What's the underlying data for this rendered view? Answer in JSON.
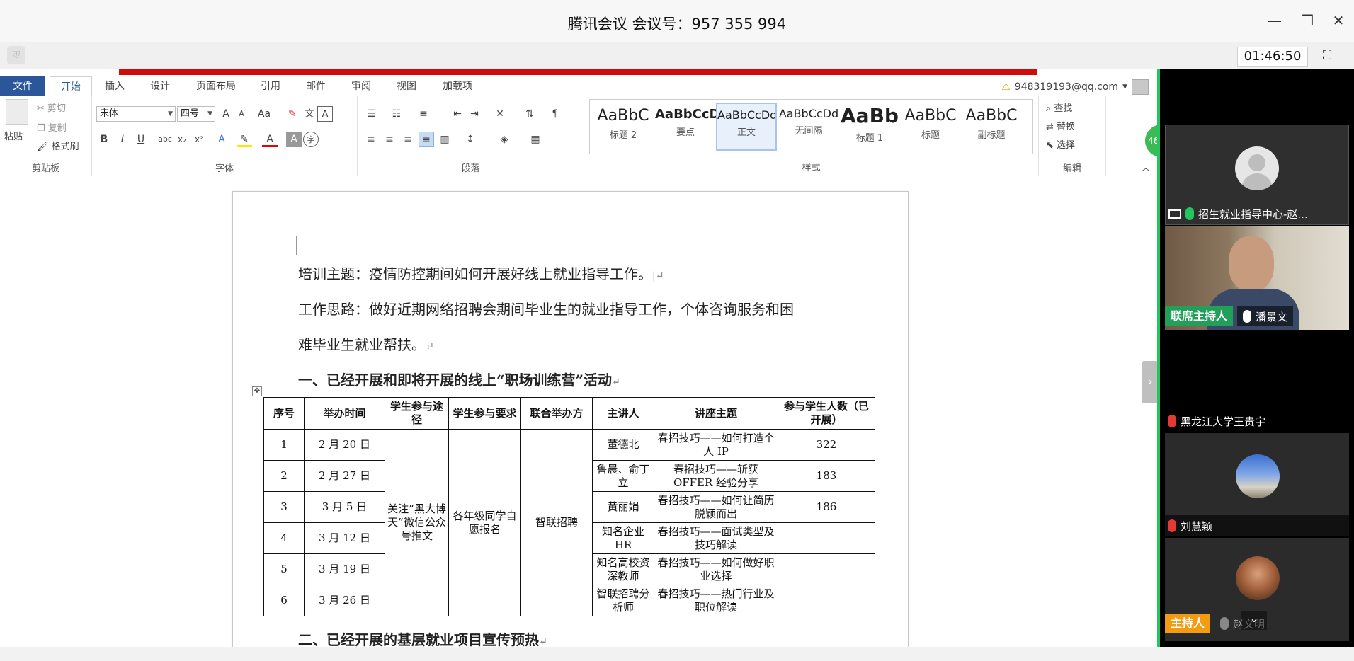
{
  "window": {
    "title": "腾讯会议 会议号：957 355 994",
    "timer": "01:46:50"
  },
  "word": {
    "tabs": [
      "文件",
      "开始",
      "插入",
      "设计",
      "页面布局",
      "引用",
      "邮件",
      "审阅",
      "视图",
      "加载项"
    ],
    "account": "948319193@qq.com",
    "clipboard": {
      "paste": "粘贴",
      "cut": "剪切",
      "copy": "复制",
      "format_painter": "格式刷",
      "label": "剪贴板"
    },
    "font": {
      "name": "宋体",
      "size": "四号",
      "label": "字体"
    },
    "paragraph_label": "段落",
    "styles": {
      "label": "样式",
      "items": [
        {
          "sample": "AaBbC",
          "name": "标题 2"
        },
        {
          "sample": "AaBbCcD",
          "name": "要点"
        },
        {
          "sample": "AaBbCcDd",
          "name": "正文"
        },
        {
          "sample": "AaBbCcDd",
          "name": "无间隔"
        },
        {
          "sample": "AaBb",
          "name": "标题 1"
        },
        {
          "sample": "AaBbC",
          "name": "标题"
        },
        {
          "sample": "AaBbC",
          "name": "副标题"
        }
      ]
    },
    "editing": {
      "find": "查找",
      "replace": "替换",
      "select": "选择",
      "label": "编辑"
    },
    "side_badge": "46"
  },
  "document": {
    "line1": "培训主题：疫情防控期间如何开展好线上就业指导工作。",
    "line2": "工作思路：做好近期网络招聘会期间毕业生的就业指导工作，个体咨询服务和困",
    "line3": "难毕业生就业帮扶。",
    "heading1": "一、已经开展和即将开展的线上“职场训练营”活动",
    "heading2": "二、已经开展的基层就业项目宣传预热",
    "table": {
      "headers": [
        "序号",
        "举办时间",
        "学生参与途径",
        "学生参与要求",
        "联合举办方",
        "主讲人",
        "讲座主题",
        "参与学生人数（已开展）"
      ],
      "merged": {
        "route": "关注“黑大博天”微信公众号推文",
        "requirement": "各年级同学自愿报名",
        "organizer": "智联招聘"
      },
      "rows": [
        {
          "no": "1",
          "date": "2 月 20 日",
          "speaker": "董德北",
          "topic": "春招技巧——如何打造个人 IP",
          "count": "322"
        },
        {
          "no": "2",
          "date": "2 月 27 日",
          "speaker": "鲁晨、俞丁立",
          "topic": "春招技巧——斩获 OFFER 经验分享",
          "count": "183"
        },
        {
          "no": "3",
          "date": "3 月 5 日",
          "speaker": "黄丽娟",
          "topic": "春招技巧——如何让简历脱颖而出",
          "count": "186"
        },
        {
          "no": "4",
          "date": "3 月 12 日",
          "speaker": "知名企业 HR",
          "topic": "春招技巧——面试类型及技巧解读",
          "count": ""
        },
        {
          "no": "5",
          "date": "3 月 19 日",
          "speaker": "知名高校资深教师",
          "topic": "春招技巧——如何做好职业选择",
          "count": ""
        },
        {
          "no": "6",
          "date": "3 月 26 日",
          "speaker": "智联招聘分析师",
          "topic": "春招技巧——热门行业及职位解读",
          "count": ""
        }
      ]
    }
  },
  "participants": [
    {
      "name": "招生就业指导中心-赵...",
      "role": "",
      "mic": "active"
    },
    {
      "name": "潘景文",
      "role": "联席主持人",
      "mic": "on"
    },
    {
      "name": "黑龙江大学王贵宇",
      "role": "",
      "mic": "muted"
    },
    {
      "name": "刘慧颖",
      "role": "",
      "mic": "muted"
    },
    {
      "name": "赵文明",
      "role": "主持人",
      "mic": "on"
    }
  ]
}
